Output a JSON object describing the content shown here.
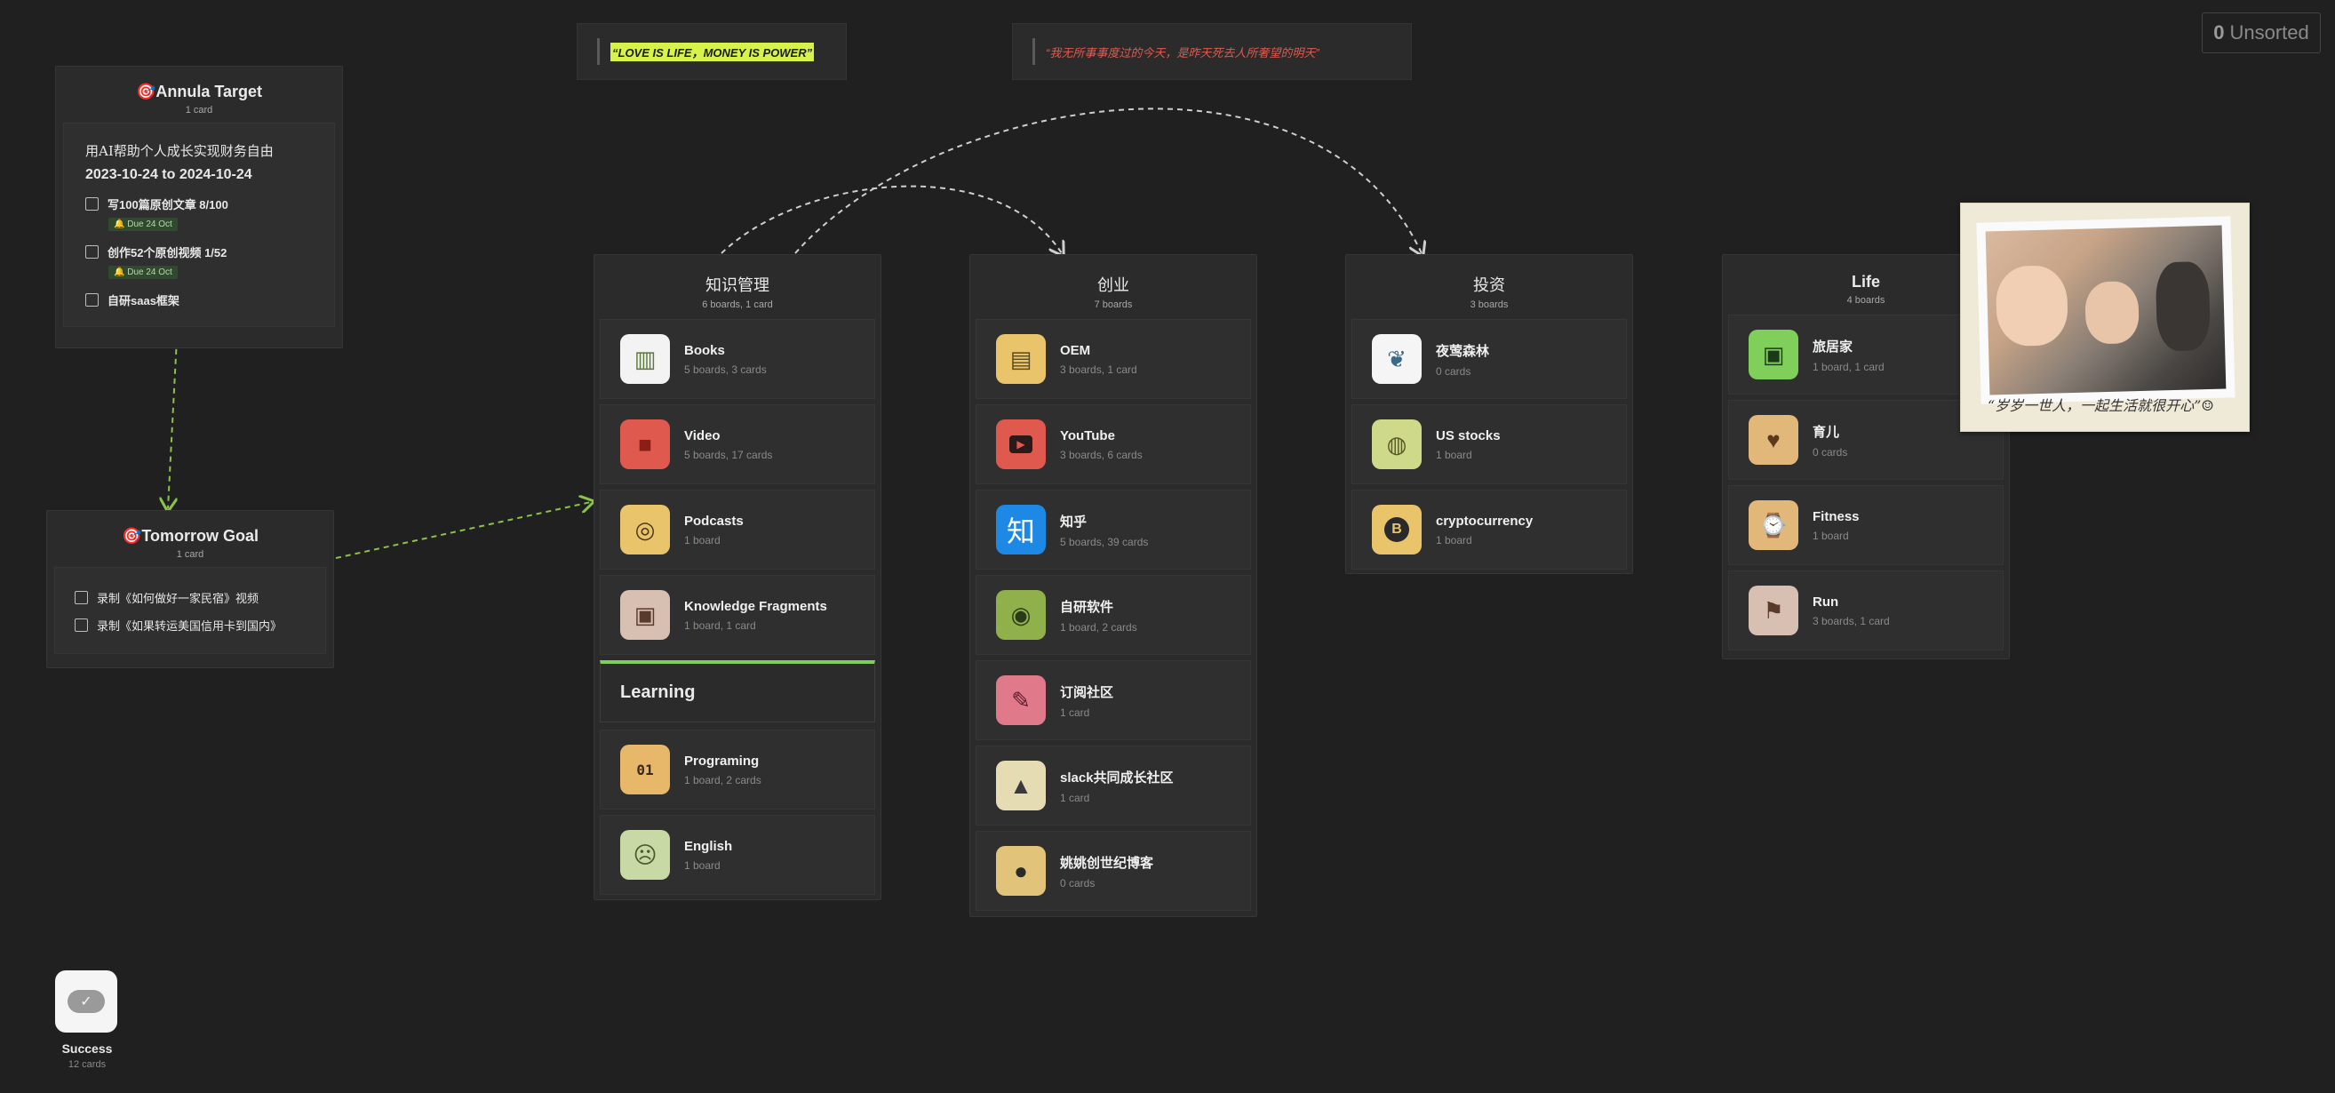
{
  "unsorted": {
    "count": "0",
    "label": "Unsorted"
  },
  "quotes": [
    {
      "text": "“LOVE IS LIFE，MONEY IS POWER”"
    },
    {
      "text": "“我无所事事度过的今天，是昨天死去人所奢望的明天”"
    }
  ],
  "annual": {
    "title": "🎯Annula Target",
    "count": "1 card",
    "goal": "用AI帮助个人成长实现财务自由",
    "dates": "2023-10-24 to 2024-10-24",
    "tasks": [
      {
        "label": "写100篇原创文章  8/100",
        "due": "Due 24 Oct"
      },
      {
        "label": "创作52个原创视频  1/52",
        "due": "Due 24 Oct"
      },
      {
        "label": "自研saas框架",
        "due": ""
      }
    ]
  },
  "tomorrow": {
    "title": "🎯Tomorrow Goal",
    "count": "1 card",
    "tasks": [
      {
        "label": "录制《如何做好一家民宿》视频"
      },
      {
        "label": "录制《如果转运美国信用卡到国内》"
      }
    ]
  },
  "columns": [
    {
      "title": "知识管理",
      "sub": "6 boards, 1 card",
      "cards": [
        {
          "title": "Books",
          "sub": "5 boards, 3 cards",
          "icon": "books-icon",
          "bg": "#f3f3f3",
          "glyph": "📚"
        },
        {
          "title": "Video",
          "sub": "5 boards, 17 cards",
          "icon": "video-camera-icon",
          "bg": "#e0594f",
          "glyph": "■"
        },
        {
          "title": "Podcasts",
          "sub": "1 board",
          "icon": "podcast-icon",
          "bg": "#e9c46a",
          "glyph": "◎"
        },
        {
          "title": "Knowledge Fragments",
          "sub": "1 board, 1 card",
          "icon": "wallet-icon",
          "bg": "#d7bfb2",
          "glyph": "▣"
        }
      ],
      "section": "Learning",
      "section_cards": [
        {
          "title": "Programing",
          "sub": "1 board, 2 cards",
          "icon": "binary-icon",
          "bg": "#e8b86a",
          "glyph": "01"
        },
        {
          "title": "English",
          "sub": "1 board",
          "icon": "face-icon",
          "bg": "#c9d9a6",
          "glyph": "☺"
        }
      ]
    },
    {
      "title": "创业",
      "sub": "7 boards",
      "cards": [
        {
          "title": "OEM",
          "sub": "3 boards, 1 card",
          "icon": "machine-icon",
          "bg": "#e9c46a",
          "glyph": "▤"
        },
        {
          "title": "YouTube",
          "sub": "3 boards, 6 cards",
          "icon": "youtube-icon",
          "bg": "#e0594f",
          "glyph": "▶"
        },
        {
          "title": "知乎",
          "sub": "5 boards, 39 cards",
          "icon": "zhihu-icon",
          "bg": "#1e88e5",
          "glyph": "知"
        },
        {
          "title": "自研软件",
          "sub": "1 board, 2 cards",
          "icon": "leaf-icon",
          "bg": "#8fb04a",
          "glyph": "◉"
        },
        {
          "title": "订阅社区",
          "sub": "1 card",
          "icon": "marker-icon",
          "bg": "#e07a8a",
          "glyph": "✎"
        },
        {
          "title": "slack共同成长社区",
          "sub": "1 card",
          "icon": "shapes-icon",
          "bg": "#e6dcb4",
          "glyph": "▲"
        },
        {
          "title": "姚姚创世纪博客",
          "sub": "0 cards",
          "icon": "bomb-icon",
          "bg": "#e2c37a",
          "glyph": "●"
        }
      ]
    },
    {
      "title": "投资",
      "sub": "3 boards",
      "cards": [
        {
          "title": "夜莺森林",
          "sub": "0 cards",
          "icon": "nightingale-logo-icon",
          "bg": "#f5f5f5",
          "glyph": "❦"
        },
        {
          "title": "US stocks",
          "sub": "1 board",
          "icon": "cookie-icon",
          "bg": "#cfd98a",
          "glyph": "◍"
        },
        {
          "title": "cryptocurrency",
          "sub": "1 board",
          "icon": "bitcoin-icon",
          "bg": "#e9c46a",
          "glyph": "₿"
        }
      ]
    },
    {
      "title": "Life",
      "sub": "4 boards",
      "cards": [
        {
          "title": "旅居家",
          "sub": "1 board, 1 card",
          "icon": "passport-icon",
          "bg": "#7fcf5a",
          "glyph": "▣"
        },
        {
          "title": "育儿",
          "sub": "0 cards",
          "icon": "heart-head-icon",
          "bg": "#e2b87a",
          "glyph": "♥"
        },
        {
          "title": "Fitness",
          "sub": "1 board",
          "icon": "watch-icon",
          "bg": "#e2b87a",
          "glyph": "⌚"
        },
        {
          "title": "Run",
          "sub": "3 boards, 1 card",
          "icon": "runner-icon",
          "bg": "#d7bfb2",
          "glyph": "⚑"
        }
      ]
    }
  ],
  "photo": {
    "caption": "“岁岁一世人，一起生活就很开心”☺"
  },
  "success": {
    "title": "Success",
    "count": "12 cards"
  }
}
